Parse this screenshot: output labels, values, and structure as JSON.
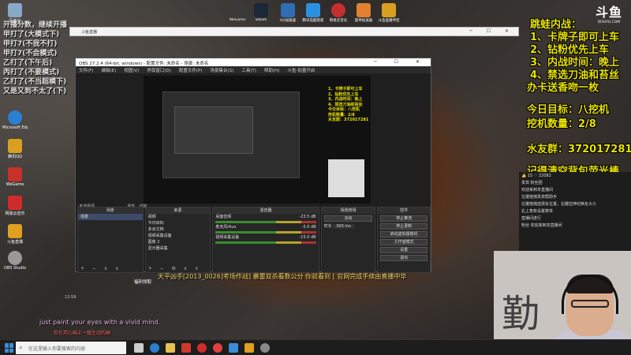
{
  "desktop": {
    "left_icons": [
      {
        "label": "回收站",
        "color": "#8aa8c8"
      },
      {
        "label": "此电脑",
        "color": "#4d7fb5"
      },
      {
        "label": "Microsoft Edge",
        "color": "#2a7fd1"
      },
      {
        "label": "腾讯QQ",
        "color": "#d8a020"
      },
      {
        "label": "WeGame",
        "color": "#c8302a"
      },
      {
        "label": "网易云音乐",
        "color": "#d02b2b"
      },
      {
        "label": "斗鱼直播",
        "color": "#e0a020"
      },
      {
        "label": "OBS Studio",
        "color": "#999999"
      }
    ],
    "top_icons": [
      {
        "label": "WeGame",
        "color": "#3a3a3a"
      },
      {
        "label": "Steam",
        "color": "#1b2838"
      },
      {
        "label": "UU加速器",
        "color": "#2f6db5"
      },
      {
        "label": "腾讯电脑管家",
        "color": "#2b90e0"
      },
      {
        "label": "网易云音乐",
        "color": "#c62f2f"
      },
      {
        "label": "雷神加速器",
        "color": "#e08030"
      },
      {
        "label": "斗鱼直播伴侣",
        "color": "#d8a020"
      }
    ],
    "left_overlay_lines": [
      "开播分数，继续开播",
      "甲打了(大模式下)",
      "甲打7(不我不打)",
      "甲打7(不会模式)",
      "乙打了(下午后)",
      "丙打了(不要模式)",
      "乙打了(不当超模下)",
      "又是又到不太了(下)"
    ]
  },
  "browser": {
    "title": "斗鱼直播"
  },
  "obs": {
    "title": "OBS 27.2.4 (64-bit, windows) - 配置文件: 未命名 - 场景: 未命名",
    "menu": [
      "文件(F)",
      "编辑(E)",
      "视图(V)",
      "停靠窗口(D)",
      "配置文件(P)",
      "场景集合(S)",
      "工具(T)",
      "帮助(H)",
      "斗鱼-批量开启"
    ],
    "preview_overlay": [
      "1、卡牌子即可上车",
      "2、钻粉优先上车",
      "3、内战时间：晚上",
      "4、禁选刀油和苔丝",
      "今日目标：八挖机",
      "挖机数量：2/8",
      "水友群：372017281"
    ],
    "tabs": [
      "未选择源",
      "属性",
      "滤镜"
    ],
    "scenes": {
      "header": "场景",
      "items": [
        "场景"
      ]
    },
    "sources": {
      "header": "来源",
      "items": [
        "视频",
        "今日目标",
        "多余文档",
        "视频采集设备",
        "图像 2",
        "显示器采集"
      ]
    },
    "mixer": {
      "header": "混音器",
      "channels": [
        {
          "name": "桌面音频",
          "db": "-23.5 dB"
        },
        {
          "name": "麦克风/Aux",
          "db": "-5.0 dB"
        },
        {
          "name": "视频采集设备",
          "db": "-15.0 dB"
        }
      ]
    },
    "transitions": {
      "header": "场景转场",
      "type": "淡出",
      "duration_label": "时长",
      "duration": "300 ms"
    },
    "controls": {
      "header": "控件",
      "buttons": [
        "停止推流",
        "停止录制",
        "启动虚拟摄像机",
        "工作室模式",
        "设置",
        "退出"
      ]
    }
  },
  "overlay_right": {
    "l1": "跳蛙内战：",
    "l2": "1、卡牌子即可上车",
    "l3": "2、钻粉优先上车",
    "l4": "3、内战时间：晚上",
    "l5": "4、禁选刀油和苔丝",
    "l6": "办卡送香吻一枚",
    "l7": "今日目标：八挖机",
    "l8": "挖机数量：2/8",
    "l9": "水友群：372017281",
    "l10": "记得清空背包荧光棒"
  },
  "logo": {
    "main": "斗鱼",
    "sub": "DOUYU.COM"
  },
  "side_panel": {
    "lines": [
      "👍 15     ♡ 22082",
      "贵宾  粉丝团",
      "欢迎来到本直播间",
      "左键拖拽贵宾帮助手",
      "左键拖拽选择友位置，右键拉伸切换友大小",
      "右上角有设置菜单",
      "直播间进行",
      "粉丝  欢迎来到本直播间"
    ]
  },
  "stream_subtitle": "天平凶手[2013_0026]考场作战] 暴雷双杀看数公分 你就看到 [ 官网完成手续由直播中华",
  "stream_tag": "福利领取",
  "stream_time": "12:59",
  "lyrics": {
    "en": "just paint your eyes with a vivid mind.",
    "zh": "你在用心画上一幅生动的画"
  },
  "taskbar": {
    "search_placeholder": "在这里输入你要搜索的内容",
    "apps": [
      {
        "name": "task-view",
        "color": "#cccccc"
      },
      {
        "name": "edge",
        "color": "#2a7fd1"
      },
      {
        "name": "explorer",
        "color": "#e8c050"
      },
      {
        "name": "wegame",
        "color": "#d03a2a"
      },
      {
        "name": "netease",
        "color": "#d02b2b"
      },
      {
        "name": "netease2",
        "color": "#e04040"
      },
      {
        "name": "qq",
        "color": "#3b8cd6"
      },
      {
        "name": "douyu",
        "color": "#e0a020"
      },
      {
        "name": "obs",
        "color": "#888888"
      }
    ]
  }
}
